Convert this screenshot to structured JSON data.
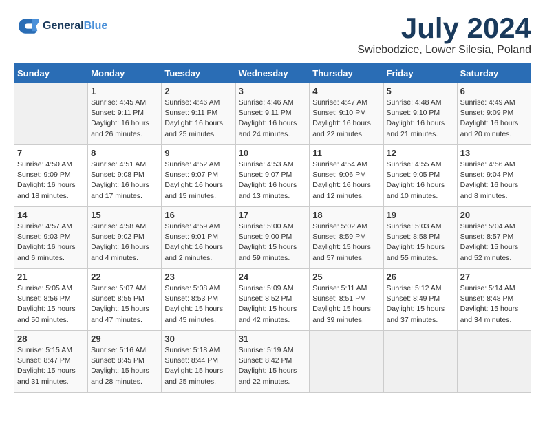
{
  "header": {
    "logo_line1": "General",
    "logo_line2": "Blue",
    "month": "July 2024",
    "location": "Swiebodzice, Lower Silesia, Poland"
  },
  "weekdays": [
    "Sunday",
    "Monday",
    "Tuesday",
    "Wednesday",
    "Thursday",
    "Friday",
    "Saturday"
  ],
  "weeks": [
    [
      {
        "day": "",
        "info": ""
      },
      {
        "day": "1",
        "info": "Sunrise: 4:45 AM\nSunset: 9:11 PM\nDaylight: 16 hours\nand 26 minutes."
      },
      {
        "day": "2",
        "info": "Sunrise: 4:46 AM\nSunset: 9:11 PM\nDaylight: 16 hours\nand 25 minutes."
      },
      {
        "day": "3",
        "info": "Sunrise: 4:46 AM\nSunset: 9:11 PM\nDaylight: 16 hours\nand 24 minutes."
      },
      {
        "day": "4",
        "info": "Sunrise: 4:47 AM\nSunset: 9:10 PM\nDaylight: 16 hours\nand 22 minutes."
      },
      {
        "day": "5",
        "info": "Sunrise: 4:48 AM\nSunset: 9:10 PM\nDaylight: 16 hours\nand 21 minutes."
      },
      {
        "day": "6",
        "info": "Sunrise: 4:49 AM\nSunset: 9:09 PM\nDaylight: 16 hours\nand 20 minutes."
      }
    ],
    [
      {
        "day": "7",
        "info": "Sunrise: 4:50 AM\nSunset: 9:09 PM\nDaylight: 16 hours\nand 18 minutes."
      },
      {
        "day": "8",
        "info": "Sunrise: 4:51 AM\nSunset: 9:08 PM\nDaylight: 16 hours\nand 17 minutes."
      },
      {
        "day": "9",
        "info": "Sunrise: 4:52 AM\nSunset: 9:07 PM\nDaylight: 16 hours\nand 15 minutes."
      },
      {
        "day": "10",
        "info": "Sunrise: 4:53 AM\nSunset: 9:07 PM\nDaylight: 16 hours\nand 13 minutes."
      },
      {
        "day": "11",
        "info": "Sunrise: 4:54 AM\nSunset: 9:06 PM\nDaylight: 16 hours\nand 12 minutes."
      },
      {
        "day": "12",
        "info": "Sunrise: 4:55 AM\nSunset: 9:05 PM\nDaylight: 16 hours\nand 10 minutes."
      },
      {
        "day": "13",
        "info": "Sunrise: 4:56 AM\nSunset: 9:04 PM\nDaylight: 16 hours\nand 8 minutes."
      }
    ],
    [
      {
        "day": "14",
        "info": "Sunrise: 4:57 AM\nSunset: 9:03 PM\nDaylight: 16 hours\nand 6 minutes."
      },
      {
        "day": "15",
        "info": "Sunrise: 4:58 AM\nSunset: 9:02 PM\nDaylight: 16 hours\nand 4 minutes."
      },
      {
        "day": "16",
        "info": "Sunrise: 4:59 AM\nSunset: 9:01 PM\nDaylight: 16 hours\nand 2 minutes."
      },
      {
        "day": "17",
        "info": "Sunrise: 5:00 AM\nSunset: 9:00 PM\nDaylight: 15 hours\nand 59 minutes."
      },
      {
        "day": "18",
        "info": "Sunrise: 5:02 AM\nSunset: 8:59 PM\nDaylight: 15 hours\nand 57 minutes."
      },
      {
        "day": "19",
        "info": "Sunrise: 5:03 AM\nSunset: 8:58 PM\nDaylight: 15 hours\nand 55 minutes."
      },
      {
        "day": "20",
        "info": "Sunrise: 5:04 AM\nSunset: 8:57 PM\nDaylight: 15 hours\nand 52 minutes."
      }
    ],
    [
      {
        "day": "21",
        "info": "Sunrise: 5:05 AM\nSunset: 8:56 PM\nDaylight: 15 hours\nand 50 minutes."
      },
      {
        "day": "22",
        "info": "Sunrise: 5:07 AM\nSunset: 8:55 PM\nDaylight: 15 hours\nand 47 minutes."
      },
      {
        "day": "23",
        "info": "Sunrise: 5:08 AM\nSunset: 8:53 PM\nDaylight: 15 hours\nand 45 minutes."
      },
      {
        "day": "24",
        "info": "Sunrise: 5:09 AM\nSunset: 8:52 PM\nDaylight: 15 hours\nand 42 minutes."
      },
      {
        "day": "25",
        "info": "Sunrise: 5:11 AM\nSunset: 8:51 PM\nDaylight: 15 hours\nand 39 minutes."
      },
      {
        "day": "26",
        "info": "Sunrise: 5:12 AM\nSunset: 8:49 PM\nDaylight: 15 hours\nand 37 minutes."
      },
      {
        "day": "27",
        "info": "Sunrise: 5:14 AM\nSunset: 8:48 PM\nDaylight: 15 hours\nand 34 minutes."
      }
    ],
    [
      {
        "day": "28",
        "info": "Sunrise: 5:15 AM\nSunset: 8:47 PM\nDaylight: 15 hours\nand 31 minutes."
      },
      {
        "day": "29",
        "info": "Sunrise: 5:16 AM\nSunset: 8:45 PM\nDaylight: 15 hours\nand 28 minutes."
      },
      {
        "day": "30",
        "info": "Sunrise: 5:18 AM\nSunset: 8:44 PM\nDaylight: 15 hours\nand 25 minutes."
      },
      {
        "day": "31",
        "info": "Sunrise: 5:19 AM\nSunset: 8:42 PM\nDaylight: 15 hours\nand 22 minutes."
      },
      {
        "day": "",
        "info": ""
      },
      {
        "day": "",
        "info": ""
      },
      {
        "day": "",
        "info": ""
      }
    ]
  ]
}
